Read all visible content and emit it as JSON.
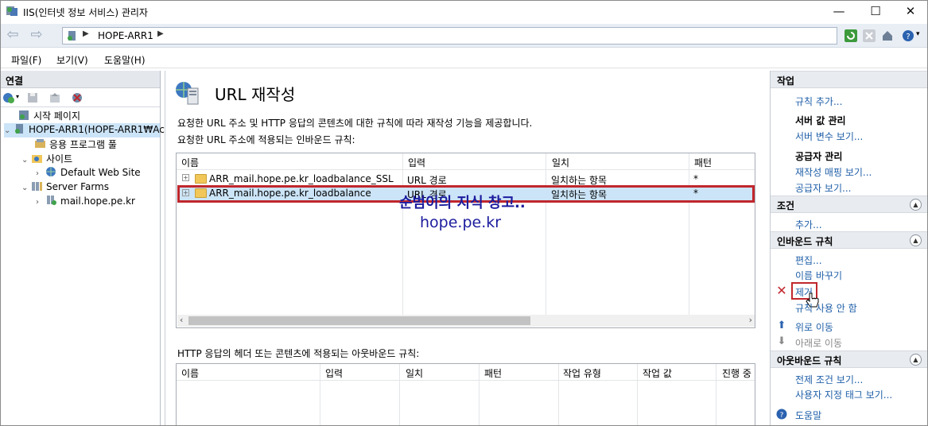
{
  "window": {
    "title": "IIS(인터넷 정보 서비스) 관리자",
    "minimize": "—",
    "maximize": "☐",
    "close": "✕"
  },
  "address": {
    "path": [
      "HOPE-ARR1"
    ]
  },
  "menu": [
    "파일(F)",
    "보기(V)",
    "도움말(H)"
  ],
  "connections": {
    "header": "연결",
    "tree": [
      {
        "label": "시작 페이지",
        "icon": "start-page-icon"
      },
      {
        "label": "HOPE-ARR1(HOPE-ARR1₩Ac",
        "icon": "server-icon"
      },
      {
        "label": "응용 프로그램 풀",
        "icon": "app-pool-icon"
      },
      {
        "label": "사이트",
        "icon": "sites-icon"
      },
      {
        "label": "Default Web Site",
        "icon": "globe-icon"
      },
      {
        "label": "Server Farms",
        "icon": "server-farms-icon"
      },
      {
        "label": "mail.hope.pe.kr",
        "icon": "server-farm-icon"
      }
    ]
  },
  "main": {
    "title": "URL 재작성",
    "description": "요청한 URL 주소 및 HTTP 응답의 콘텐츠에 대한 규칙에 따라 재작성 기능을 제공합니다.",
    "inbound_label": "요청한 URL 주소에 적용되는 인바운드 규칙:",
    "inbound_columns": [
      "이름",
      "입력",
      "일치",
      "패턴"
    ],
    "inbound_rows": [
      {
        "name": "ARR_mail.hope.pe.kr_loadbalance_SSL",
        "input": "URL 경로",
        "match": "일치하는 항목",
        "pattern": "*"
      },
      {
        "name": "ARR_mail.hope.pe.kr_loadbalance",
        "input": "URL 경로",
        "match": "일치하는 항목",
        "pattern": "*"
      }
    ],
    "watermark_line1": "순범이의 지식 창고..",
    "watermark_line2": "hope.pe.kr",
    "outbound_label": "HTTP 응답의 헤더 또는 콘텐츠에 적용되는 아웃바운드 규칙:",
    "outbound_columns": [
      "이름",
      "입력",
      "일치",
      "패턴",
      "작업 유형",
      "작업 값",
      "진행 중"
    ]
  },
  "actions": {
    "header": "작업",
    "add_rule": "규칙 추가...",
    "server_vars_group": "서버 값 관리",
    "view_server_vars": "서버 변수 보기...",
    "provider_group": "공급자 관리",
    "view_rewrite_maps": "재작성 매핑 보기...",
    "view_providers": "공급자 보기...",
    "conditions_header": "조건",
    "add": "추가...",
    "inbound_header": "인바운드 규칙",
    "edit": "편집...",
    "rename": "이름 바꾸기",
    "remove": "제거",
    "disable_rule": "규칙 사용 안 함",
    "move_up": "위로 이동",
    "move_down": "아래로 이동",
    "outbound_header": "아웃바운드 규칙",
    "view_preconditions": "전제 조건 보기...",
    "view_custom_tags": "사용자 지정 태그 보기...",
    "help": "도움말"
  }
}
